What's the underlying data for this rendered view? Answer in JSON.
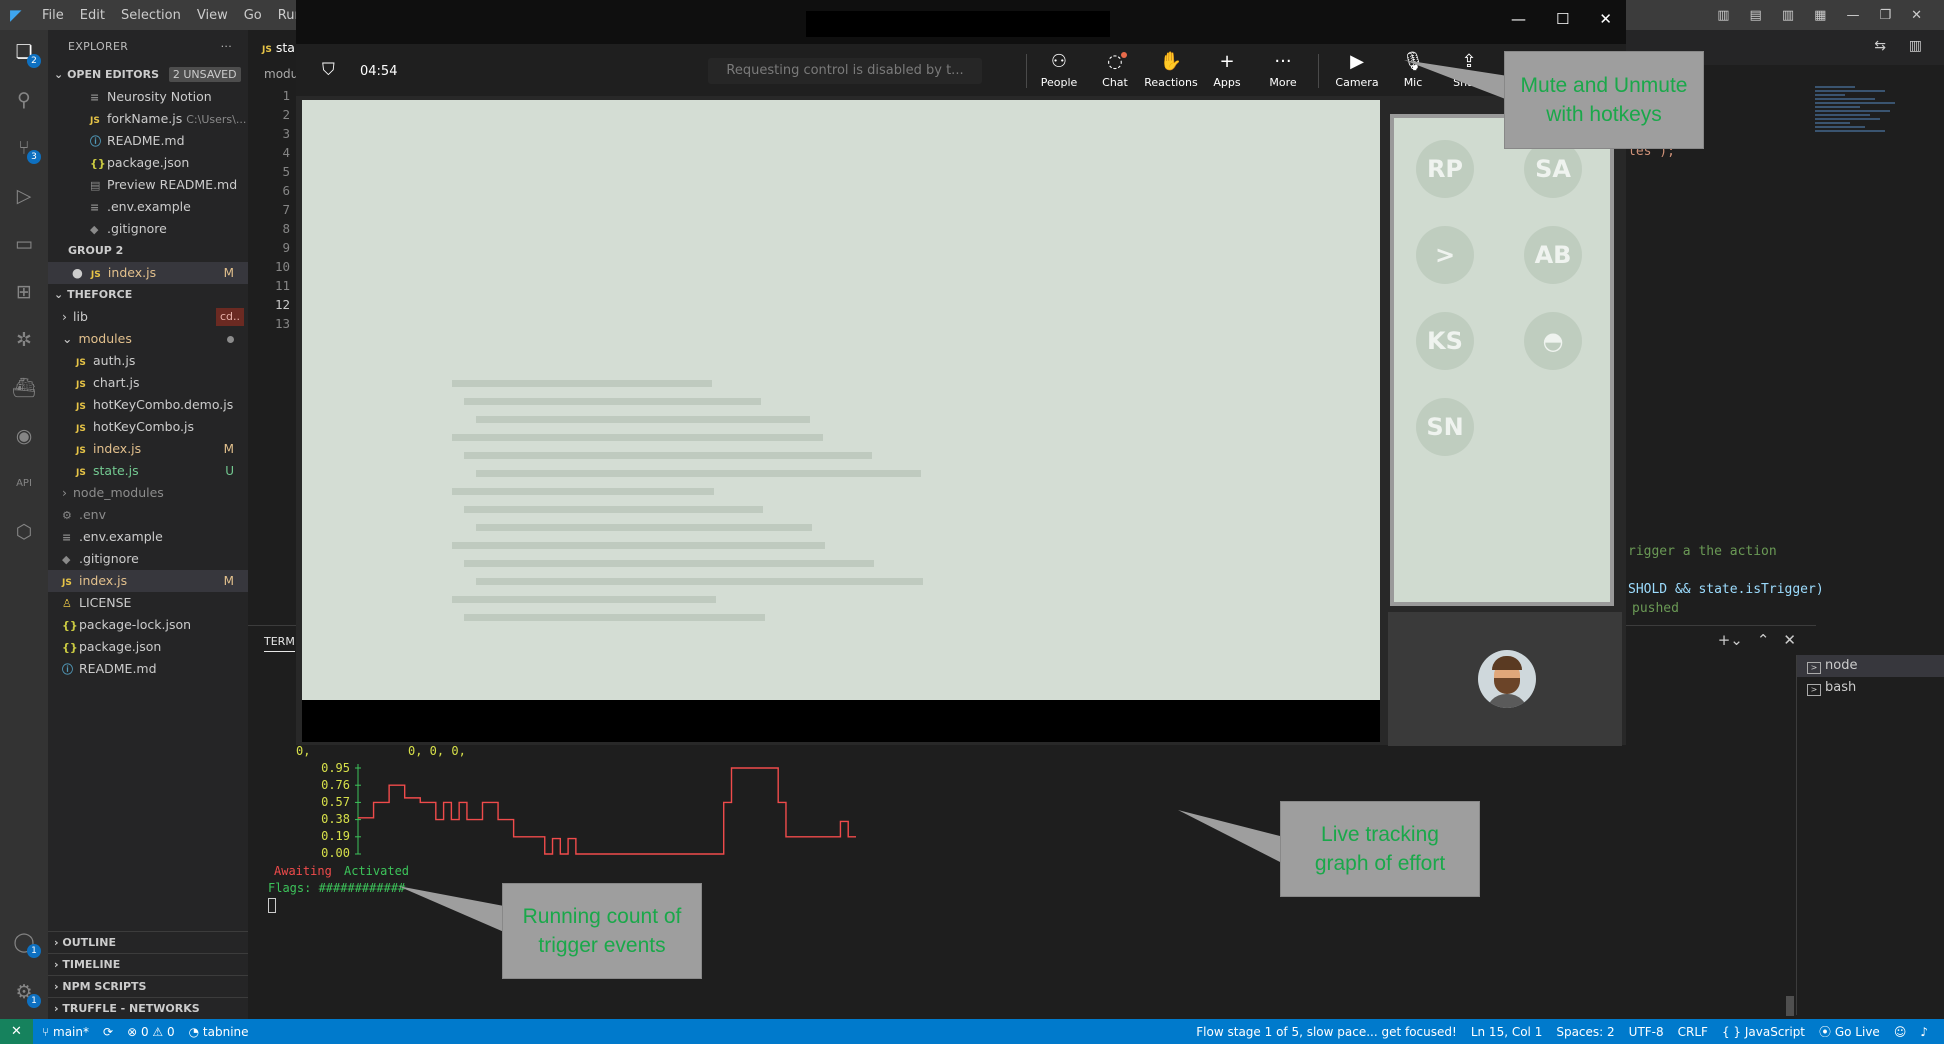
{
  "menu": [
    "File",
    "Edit",
    "Selection",
    "View",
    "Go",
    "Run"
  ],
  "explorer": {
    "title": "EXPLORER",
    "open_editors_label": "OPEN EDITORS",
    "unsaved_badge": "2 UNSAVED",
    "open_editors": [
      {
        "name": "Neurosity Notion",
        "icon": "lines"
      },
      {
        "name": "forkName.js",
        "icon": "JS",
        "detail": "C:\\Users\\..."
      },
      {
        "name": "README.md",
        "icon": "info"
      },
      {
        "name": "package.json",
        "icon": "json"
      },
      {
        "name": "Preview README.md",
        "icon": "preview"
      },
      {
        "name": ".env.example",
        "icon": "lines"
      },
      {
        "name": ".gitignore",
        "icon": "git"
      }
    ],
    "group2_label": "GROUP 2",
    "group2_file": "index.js",
    "group2_mark": "M",
    "project_label": "THEFORCE",
    "lib_folder": "lib",
    "lib_badge": "cd..",
    "modules_folder": "modules",
    "module_files": [
      {
        "name": "auth.js",
        "mark": ""
      },
      {
        "name": "chart.js",
        "mark": ""
      },
      {
        "name": "hotKeyCombo.demo.js",
        "mark": ""
      },
      {
        "name": "hotKeyCombo.js",
        "mark": ""
      },
      {
        "name": "index.js",
        "mark": "M"
      },
      {
        "name": "state.js",
        "mark": "U"
      }
    ],
    "node_modules": "node_modules",
    "root_files": [
      {
        "name": ".env",
        "icon": "gear",
        "mark": ""
      },
      {
        "name": ".env.example",
        "icon": "lines",
        "mark": ""
      },
      {
        "name": ".gitignore",
        "icon": "git",
        "mark": ""
      },
      {
        "name": "index.js",
        "icon": "JS",
        "mark": "M"
      },
      {
        "name": "LICENSE",
        "icon": "license",
        "mark": ""
      },
      {
        "name": "package-lock.json",
        "icon": "json",
        "mark": ""
      },
      {
        "name": "package.json",
        "icon": "json",
        "mark": ""
      },
      {
        "name": "README.md",
        "icon": "info",
        "mark": ""
      }
    ],
    "bottom_sections": [
      "OUTLINE",
      "TIMELINE",
      "NPM SCRIPTS",
      "TRUFFLE - NETWORKS"
    ]
  },
  "activity_badges": {
    "explorer": "2",
    "scm": "3",
    "accounts": "1",
    "settings": "1"
  },
  "editor": {
    "tab_label": "sta",
    "breadcrumb": "modu",
    "line_numbers": [
      "1",
      "2",
      "3",
      "4",
      "5",
      "6",
      "7",
      "8",
      "9",
      "10",
      "11",
      "12",
      "13"
    ],
    "current_line": "12",
    "code_fragment_1": "les\");",
    "code_comment": "rigger a the action",
    "code_cond": "SHOLD && state.isTrigger)",
    "code_pushed": "pushed"
  },
  "panel": {
    "title": "TERM",
    "terminals": [
      "node",
      "bash"
    ],
    "zero_row_left": "0,",
    "zero_row_right": "0, 0, 0,",
    "y_ticks": [
      "0.95",
      "0.76",
      "0.57",
      "0.38",
      "0.19",
      "0.00"
    ],
    "awaiting_label": "Awaiting",
    "activated_label": "Activated",
    "flags_line": "Flags: ############"
  },
  "meeting": {
    "timer": "04:54",
    "request_control": "Requesting control is disabled by t...",
    "buttons": [
      "People",
      "Chat",
      "Reactions",
      "Apps",
      "More",
      "Camera",
      "Mic",
      "Share"
    ],
    "participants": [
      "RP",
      "SA",
      "AB",
      "KS",
      "SN"
    ]
  },
  "annotations": {
    "mute": "Mute and Unmute with hotkeys",
    "graph": "Live tracking graph of effort",
    "count": "Running count of trigger events"
  },
  "statusbar": {
    "branch": "main*",
    "errors": "0",
    "warnings": "0",
    "tabnine": "tabnine",
    "flow_stage": "Flow stage 1 of 5, slow pace... get focused!",
    "position": "Ln 15, Col 1",
    "spaces": "Spaces: 2",
    "encoding": "UTF-8",
    "eol": "CRLF",
    "language": "JavaScript",
    "golive": "Go Live"
  },
  "chart_data": {
    "type": "line",
    "title": "",
    "xlabel": "",
    "ylabel": "",
    "ylim": [
      0,
      0.95
    ],
    "y_ticks": [
      0.95,
      0.76,
      0.57,
      0.38,
      0.19,
      0.0
    ],
    "series": [
      {
        "color": "#f04b4b",
        "values": [
          0.4,
          0.4,
          0.57,
          0.57,
          0.76,
          0.76,
          0.62,
          0.62,
          0.57,
          0.57,
          0.38,
          0.57,
          0.38,
          0.57,
          0.38,
          0.38,
          0.57,
          0.57,
          0.38,
          0.38,
          0.19,
          0.19,
          0.19,
          0.19,
          0.0,
          0.17,
          0.0,
          0.17,
          0.0,
          0.0,
          0.0,
          0.0,
          0.0,
          0.0,
          0.0,
          0.0,
          0.0,
          0.0,
          0.0,
          0.0,
          0.0,
          0.0,
          0.0,
          0.0,
          0.0,
          0.0,
          0.0,
          0.57,
          0.95,
          0.95,
          0.95,
          0.95,
          0.95,
          0.95,
          0.57,
          0.19,
          0.19,
          0.19,
          0.19,
          0.19,
          0.19,
          0.19,
          0.36,
          0.19,
          0.19
        ]
      }
    ]
  }
}
